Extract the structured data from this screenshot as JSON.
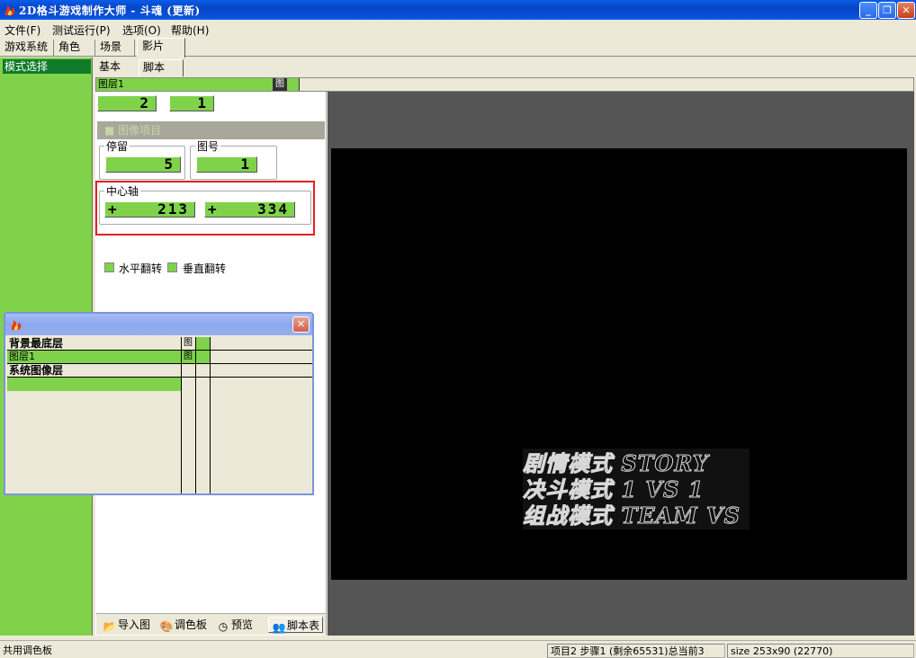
{
  "window": {
    "title": "2D格斗游戏制作大师 - 斗魂 (更新)",
    "min": "_",
    "max": "❐",
    "close": "✕"
  },
  "menu": [
    "文件(F)",
    "测试运行(P)",
    "选项(O)",
    "帮助(H)"
  ],
  "top_tabs": [
    "游戏系统",
    "角色",
    "场景",
    "影片"
  ],
  "left_panel": {
    "mode_select": "模式选择"
  },
  "sub_tabs": [
    "基本",
    "脚本"
  ],
  "layer_bar": {
    "layer_name": "图层1",
    "img_icon": "图"
  },
  "frame_fields": {
    "a": "2",
    "b": "1"
  },
  "section_bar": {
    "label": "■ 图像项目"
  },
  "stay": {
    "label": "停留",
    "value": "5"
  },
  "image_no": {
    "label": "图号",
    "value": "1"
  },
  "center_axis": {
    "label": "中心轴",
    "x": "213",
    "y": "334",
    "x_sign": "+",
    "y_sign": "+"
  },
  "flip": {
    "horizontal": "水平翻转",
    "vertical": "垂直翻转"
  },
  "bottom_tools": [
    {
      "label": "导入图",
      "icon": "folder-icon"
    },
    {
      "label": "调色板",
      "icon": "palette-icon"
    },
    {
      "label": "预览",
      "icon": "clock-icon"
    },
    {
      "label": "脚本表",
      "icon": "people-icon"
    }
  ],
  "canvas_sprite": {
    "lines": [
      "剧情模式 STORY",
      "决斗模式 1 VS 1",
      "组战模式 TEAM VS"
    ]
  },
  "layer_window": {
    "close": "✕",
    "rows": [
      {
        "name": "背景最底层",
        "img": "图"
      },
      {
        "name": "图层1",
        "img": "图"
      },
      {
        "name": "系统图像层",
        "img": ""
      }
    ]
  },
  "statusbar": {
    "left": "共用调色板",
    "middle": "项目2 步骤1 (剩余65531)总当前3",
    "right": "size 253x90 (22770)"
  },
  "colors": {
    "accent_green": "#7fd24a",
    "highlight_red": "#e02020",
    "title_blue": "#0646c8"
  }
}
